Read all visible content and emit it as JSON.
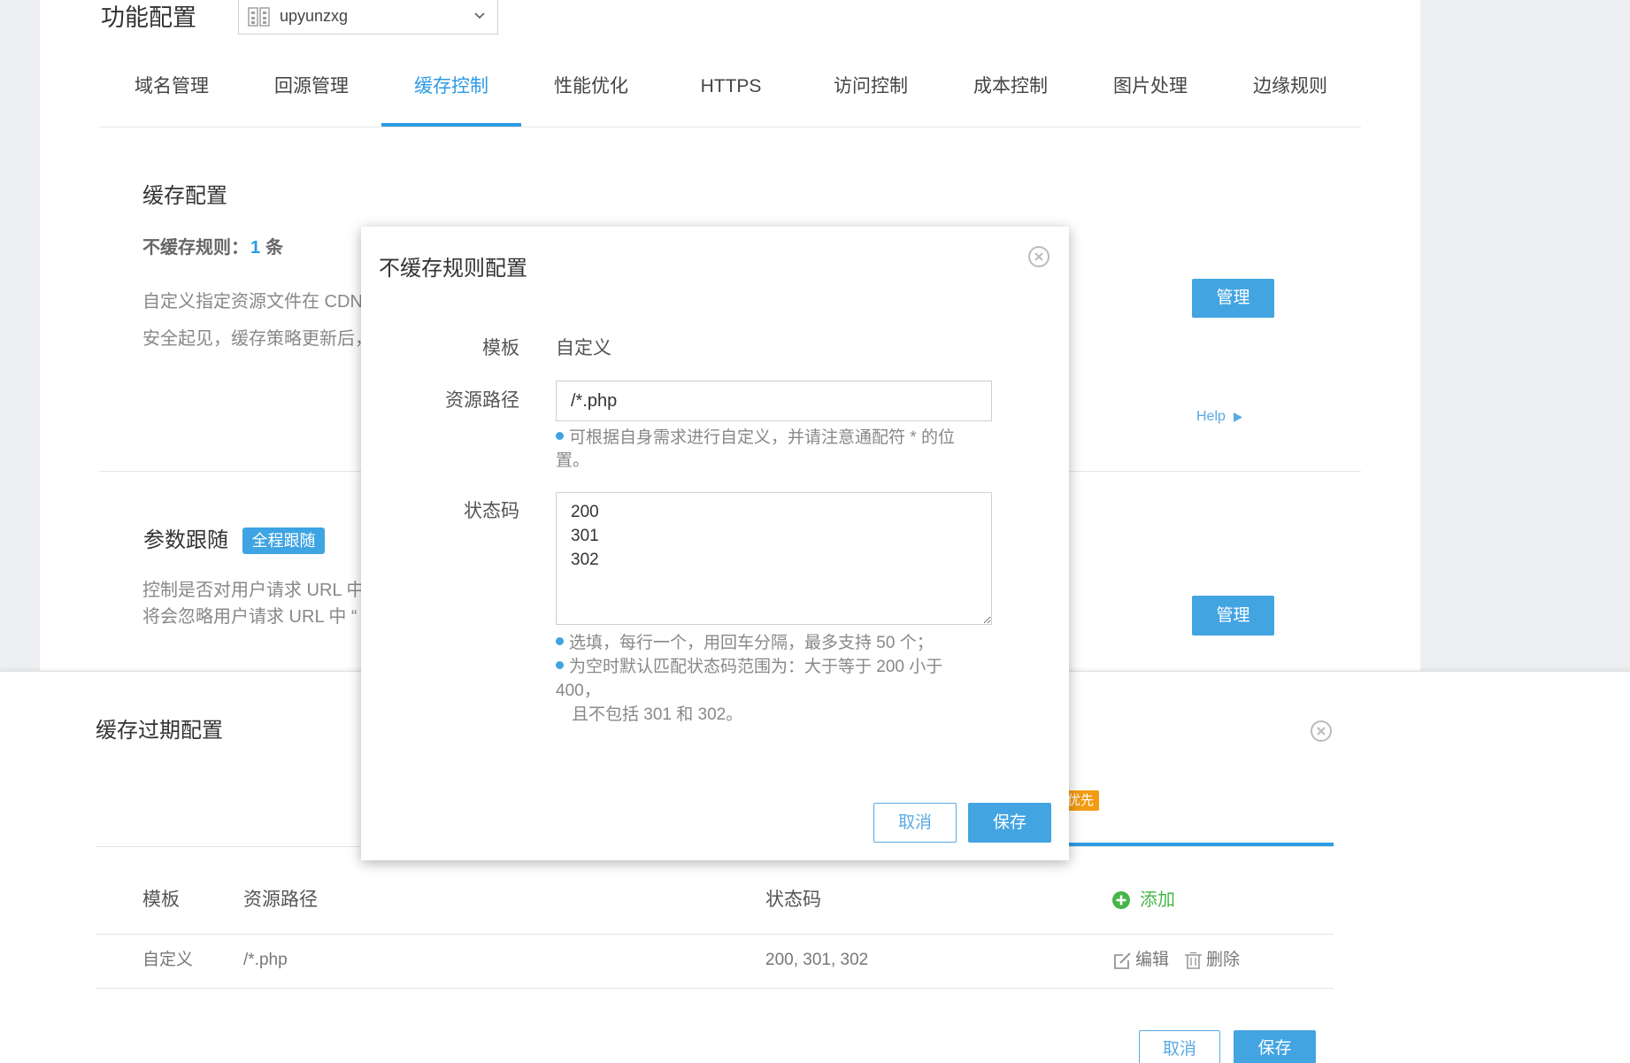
{
  "header": {
    "title": "功能配置",
    "domain_select": {
      "value": "upyunzxg",
      "icon": "domain-icon",
      "chevron": "chevron-down-icon"
    }
  },
  "tabs": {
    "active_index": 2,
    "items": [
      {
        "label": "域名管理"
      },
      {
        "label": "回源管理"
      },
      {
        "label": "缓存控制"
      },
      {
        "label": "性能优化"
      },
      {
        "label": "HTTPS"
      },
      {
        "label": "访问控制"
      },
      {
        "label": "成本控制"
      },
      {
        "label": "图片处理"
      },
      {
        "label": "边缘规则"
      }
    ]
  },
  "cache_config": {
    "title": "缓存配置",
    "rule_label": "不缓存规则：",
    "rule_count": "1",
    "rule_unit": "条",
    "desc_lines": [
      "自定义指定资源文件在 CDN",
      "安全起见，缓存策略更新后，"
    ],
    "manage_label": "管理",
    "help_label": "Help",
    "help_icon": "triangle-right-icon"
  },
  "param_follow": {
    "title": "参数跟随",
    "badge": "全程跟随",
    "desc_lines": [
      "控制是否对用户请求 URL 中",
      "将会忽略用户请求 URL 中 “"
    ],
    "manage_label": "管理"
  },
  "expire_panel": {
    "title": "缓存过期配置",
    "close_icon": "close-icon",
    "priority_badge": "优先",
    "table": {
      "headers": [
        "模板",
        "资源路径",
        "状态码"
      ],
      "add_label": "添加",
      "add_icon": "plus-circle-icon",
      "rows": [
        {
          "template": "自定义",
          "path": "/*.php",
          "codes": "200, 301, 302",
          "edit": "编辑",
          "delete": "删除"
        }
      ]
    },
    "cancel_label": "取消",
    "save_label": "保存"
  },
  "modal": {
    "title": "不缓存规则配置",
    "close_icon": "close-icon",
    "template_label": "模板",
    "template_value": "自定义",
    "path_label": "资源路径",
    "path_value": "/*.php",
    "path_hint": "可根据自身需求进行自定义，并请注意通配符 * 的位置。",
    "status_label": "状态码",
    "status_value": "200\n301\n302",
    "status_hints": [
      "选填，每行一个，用回车分隔，最多支持 50 个；",
      "为空时默认匹配状态码范围为：大于等于 200 小于 400，",
      "且不包括 301 和 302。"
    ],
    "cancel_label": "取消",
    "save_label": "保存"
  },
  "colors": {
    "primary": "#43a4e2",
    "active_tab": "#2b9be5",
    "priority_orange": "#f39c12",
    "add_green": "#46b549",
    "page_background": "#edeff3"
  }
}
